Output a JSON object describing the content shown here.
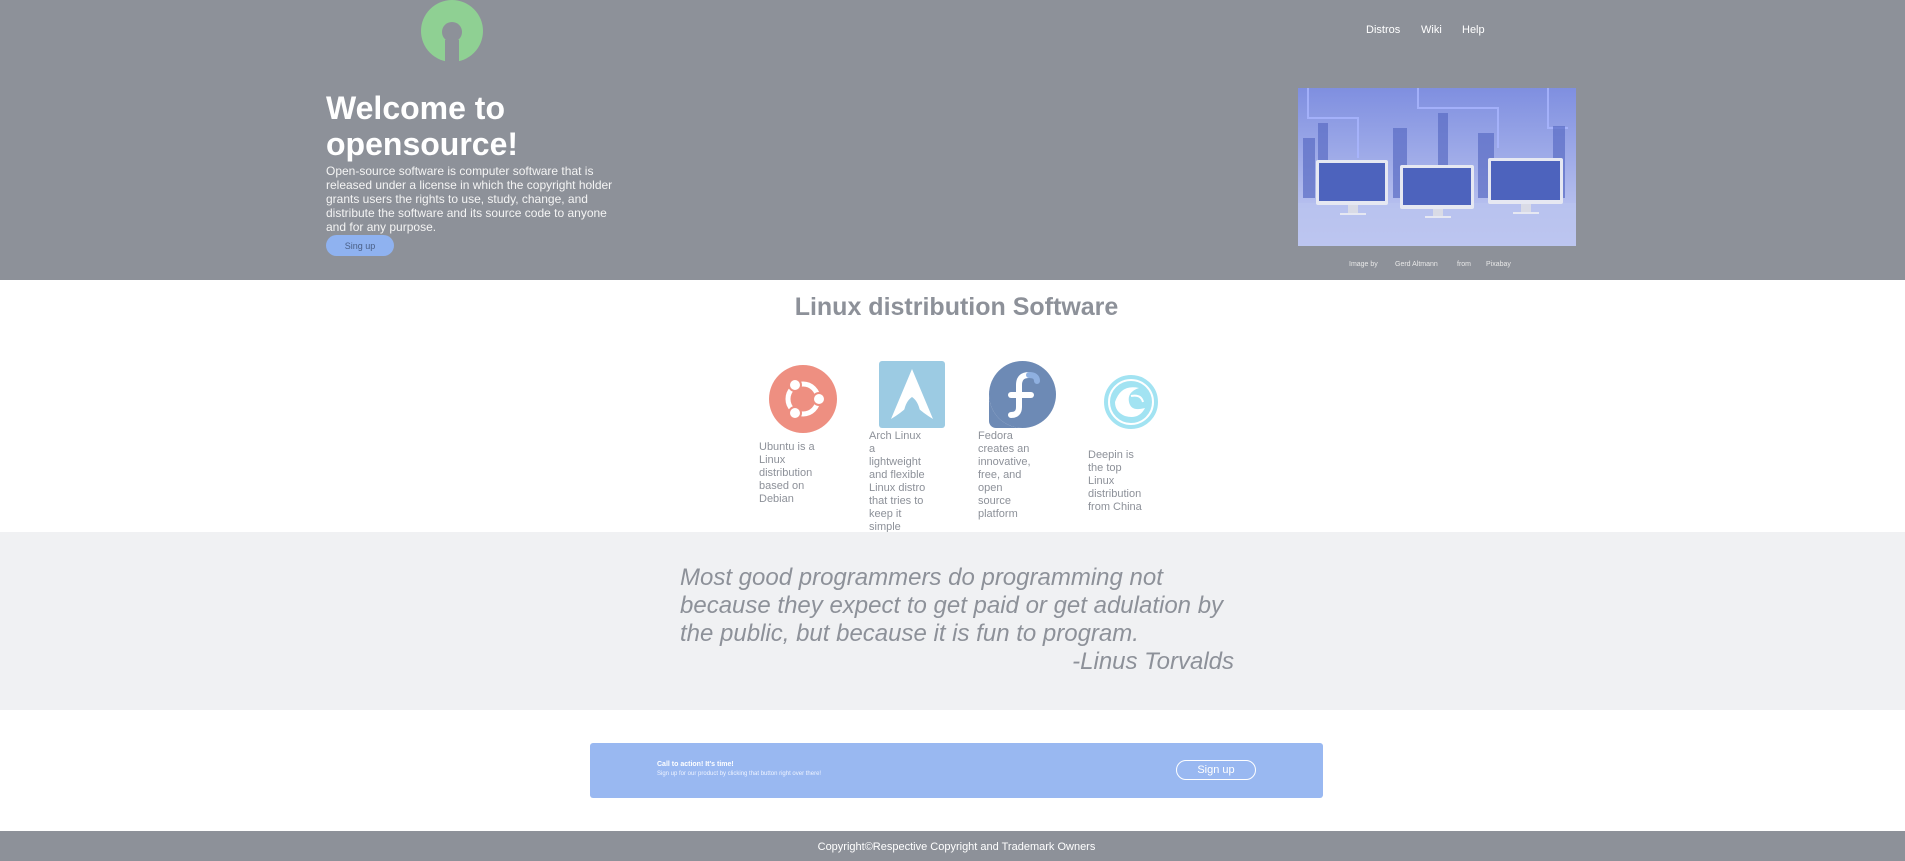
{
  "colors": {
    "hero_bg": "#8d9199",
    "accent": "#99b8f1",
    "logo_green": "#8fd093",
    "quote_bg": "#f0f1f3"
  },
  "header": {
    "logo_icon": "open-source-initiative-logo",
    "nav": [
      {
        "label": "Distros"
      },
      {
        "label": "Wiki"
      },
      {
        "label": "Help"
      }
    ]
  },
  "hero": {
    "title": "Welcome to opensource!",
    "description": "Open-source software is computer software that is released under a license in which the copyright holder grants users the rights to use, study, change, and distribute the software and its source code to anyone and for any purpose.",
    "button_label": "Sing up",
    "image_icon": "computer-monitors-city-photo",
    "credit": {
      "prefix": "Image by",
      "author": "Gerd Altmann",
      "from": "from",
      "source": "Pixabay"
    }
  },
  "distros": {
    "title": "Linux distribution Software",
    "items": [
      {
        "icon": "ubuntu-logo-icon",
        "text": "Ubuntu is a Linux distribution based on Debian"
      },
      {
        "icon": "arch-linux-logo-icon",
        "text": "Arch Linux a lightweight and flexible Linux distro that tries to keep it simple"
      },
      {
        "icon": "fedora-logo-icon",
        "text": "Fedora creates an innovative, free, and open source platform"
      },
      {
        "icon": "deepin-logo-icon",
        "text": "Deepin is the top Linux distribution from China"
      }
    ]
  },
  "quote": {
    "text": "Most good programmers do programming not because they expect to get paid or get adulation by the public, but because it is fun to program.",
    "author": "-Linus Torvalds"
  },
  "cta": {
    "title": "Call to action! It's time!",
    "subtitle": "Sign up for our product by clicking that button right over there!",
    "button_label": "Sign up"
  },
  "footer": {
    "text": "Copyright©Respective Copyright and Trademark Owners"
  }
}
